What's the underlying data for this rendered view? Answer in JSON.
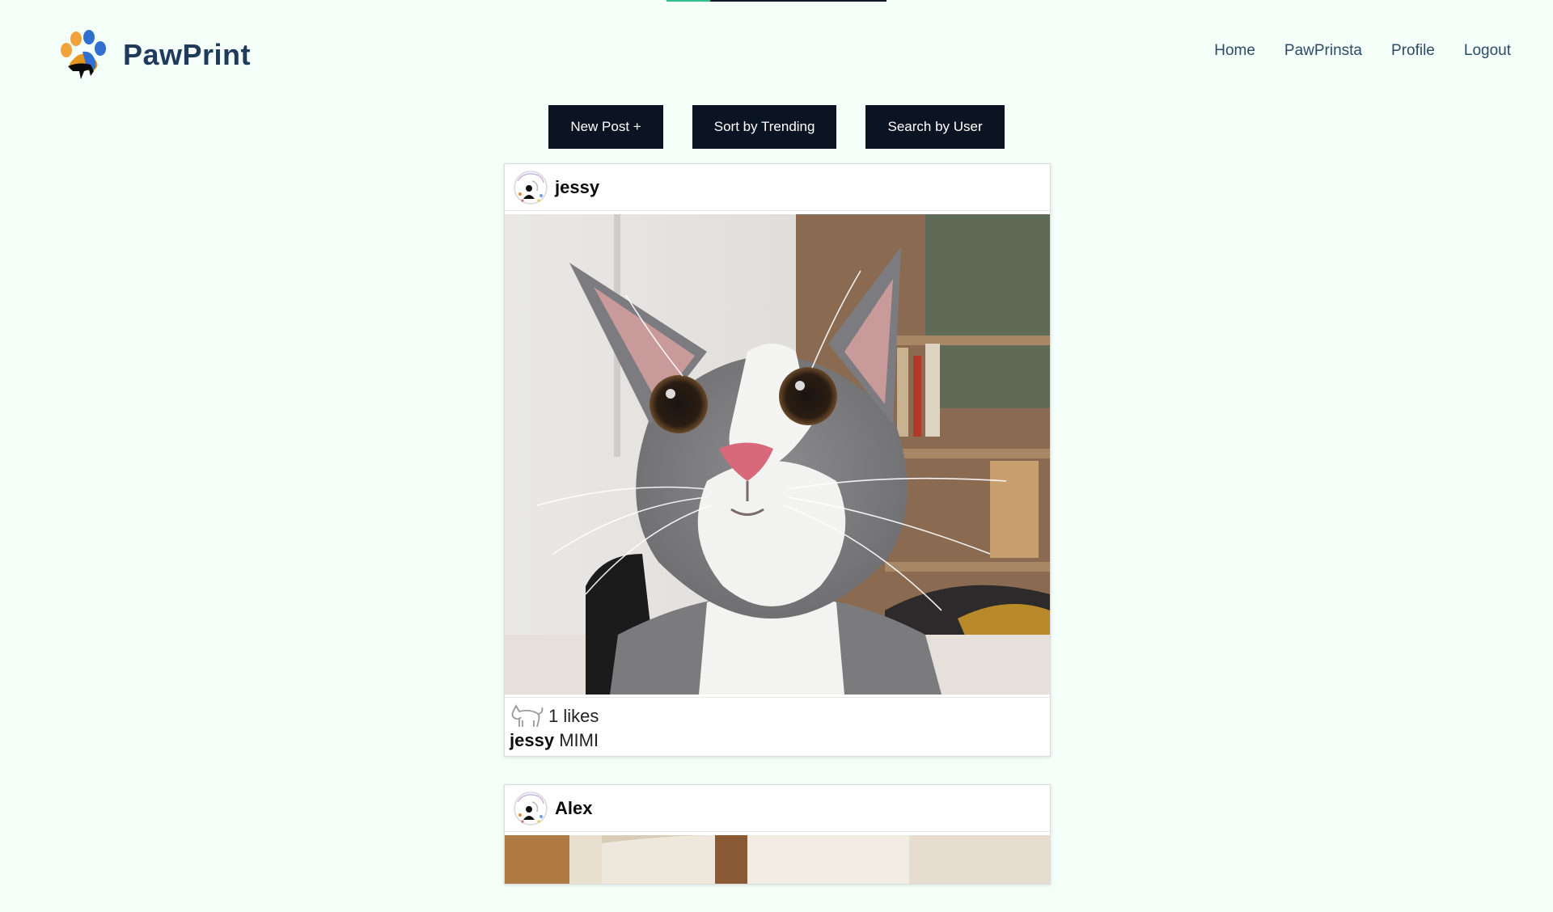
{
  "progress": {
    "fraction": 0.2
  },
  "brand": {
    "name": "PawPrint",
    "logo_icon": "paw-logo-icon"
  },
  "nav": {
    "items": [
      {
        "label": "Home"
      },
      {
        "label": "PawPrinsta"
      },
      {
        "label": "Profile"
      },
      {
        "label": "Logout"
      }
    ]
  },
  "toolbar": {
    "new_post_label": "New Post +",
    "sort_label": "Sort by Trending",
    "search_label": "Search by User"
  },
  "posts": [
    {
      "username": "jessy",
      "likes_text": "1 likes",
      "caption_user": "jessy",
      "caption_text": "MIMI",
      "image_icon": "cat-photo"
    },
    {
      "username": "Alex",
      "image_icon": "room-photo"
    }
  ],
  "colors": {
    "background": "#f5fffa",
    "button_bg": "#0b1423",
    "brand_text": "#1f3b5c",
    "progress_accent": "#2ec28a"
  }
}
